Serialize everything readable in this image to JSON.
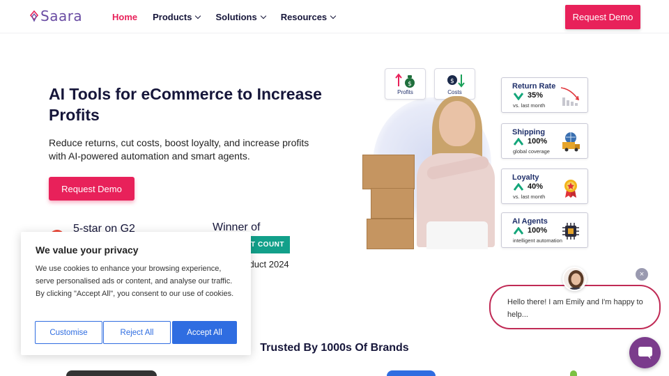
{
  "header": {
    "logo_text": "Saara",
    "nav": [
      {
        "label": "Home",
        "active": true,
        "dropdown": false
      },
      {
        "label": "Products",
        "active": false,
        "dropdown": true
      },
      {
        "label": "Solutions",
        "active": false,
        "dropdown": true
      },
      {
        "label": "Resources",
        "active": false,
        "dropdown": true
      }
    ],
    "cta_label": "Request Demo"
  },
  "hero": {
    "title": "AI Tools for eCommerce to Increase Profits",
    "subtitle": "Reduce returns, cut costs, boost loyalty, and increase profits with AI-powered automation and smart agents.",
    "cta_label": "Request Demo",
    "g2_text": "5-star on G2",
    "winner_text": "Winner of",
    "badge_text": "AT COUNT",
    "product_year": "roduct 2024"
  },
  "hero_cards": [
    {
      "label": "Profits",
      "icon": "money-bag-up-icon"
    },
    {
      "label": "Costs",
      "icon": "money-bag-down-icon"
    }
  ],
  "stats": [
    {
      "title": "Return Rate",
      "value": "35%",
      "sub": "vs. last month",
      "trend": "down",
      "icon": "declining-bar-chart-icon"
    },
    {
      "title": "Shipping",
      "value": "100%",
      "sub": "global coverage",
      "trend": "up",
      "icon": "delivery-truck-globe-icon"
    },
    {
      "title": "Loyalty",
      "value": "40%",
      "sub": "vs. last month",
      "trend": "up",
      "icon": "award-medal-icon"
    },
    {
      "title": "AI Agents",
      "value": "100%",
      "sub": "intelligent automation",
      "trend": "up",
      "icon": "ai-chip-icon"
    }
  ],
  "trusted_heading": "Trusted By 1000s Of Brands",
  "cookie": {
    "title": "We value your privacy",
    "body": "We use cookies to enhance your browsing experience, serve personalised ads or content, and analyse our traffic. By clicking \"Accept All\", you consent to our use of cookies.",
    "buttons": [
      "Customise",
      "Reject All",
      "Accept All"
    ]
  },
  "chat": {
    "message": "Hello there! I am Emily and I'm happy to help...",
    "close_glyph": "×"
  },
  "colors": {
    "brand_pink": "#e8215a",
    "brand_purple": "#6a4ca3",
    "cookie_blue": "#2f6de1",
    "badge_teal": "#12a08a",
    "chat_border": "#c02a55",
    "chat_launcher": "#7b3c8c",
    "trend_green": "#13a67a"
  }
}
